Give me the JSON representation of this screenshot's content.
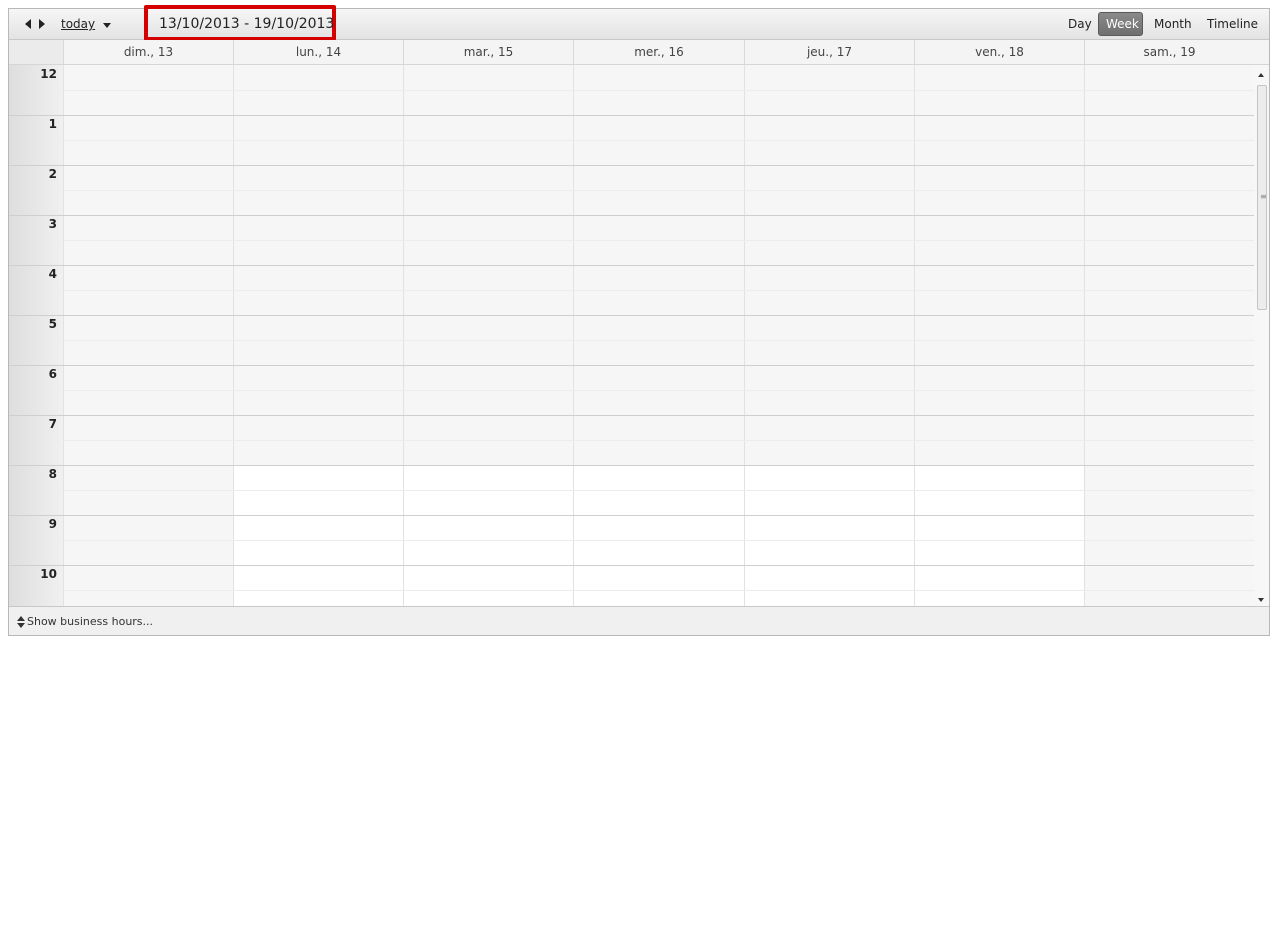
{
  "toolbar": {
    "today_label": "today",
    "date_range": "13/10/2013 - 19/10/2013",
    "views": [
      {
        "label": "Day",
        "active": false
      },
      {
        "label": "Week",
        "active": true
      },
      {
        "label": "Month",
        "active": false
      },
      {
        "label": "Timeline",
        "active": false
      }
    ]
  },
  "days": [
    {
      "label": "dim., 13",
      "business": false
    },
    {
      "label": "lun., 14",
      "business": true
    },
    {
      "label": "mar., 15",
      "business": true
    },
    {
      "label": "mer., 16",
      "business": true
    },
    {
      "label": "jeu., 17",
      "business": true
    },
    {
      "label": "ven., 18",
      "business": true
    },
    {
      "label": "sam., 19",
      "business": false
    }
  ],
  "hours": [
    "12",
    "1",
    "2",
    "3",
    "4",
    "5",
    "6",
    "7",
    "8",
    "9",
    "10"
  ],
  "business_start_hour_index": 8,
  "footer": {
    "toggle_label": "Show business hours..."
  },
  "colors": {
    "highlight_border": "#d40000",
    "non_business_bg": "#f6f6f6",
    "business_bg": "#ffffff",
    "active_view_bg": "#7a7a7a"
  }
}
